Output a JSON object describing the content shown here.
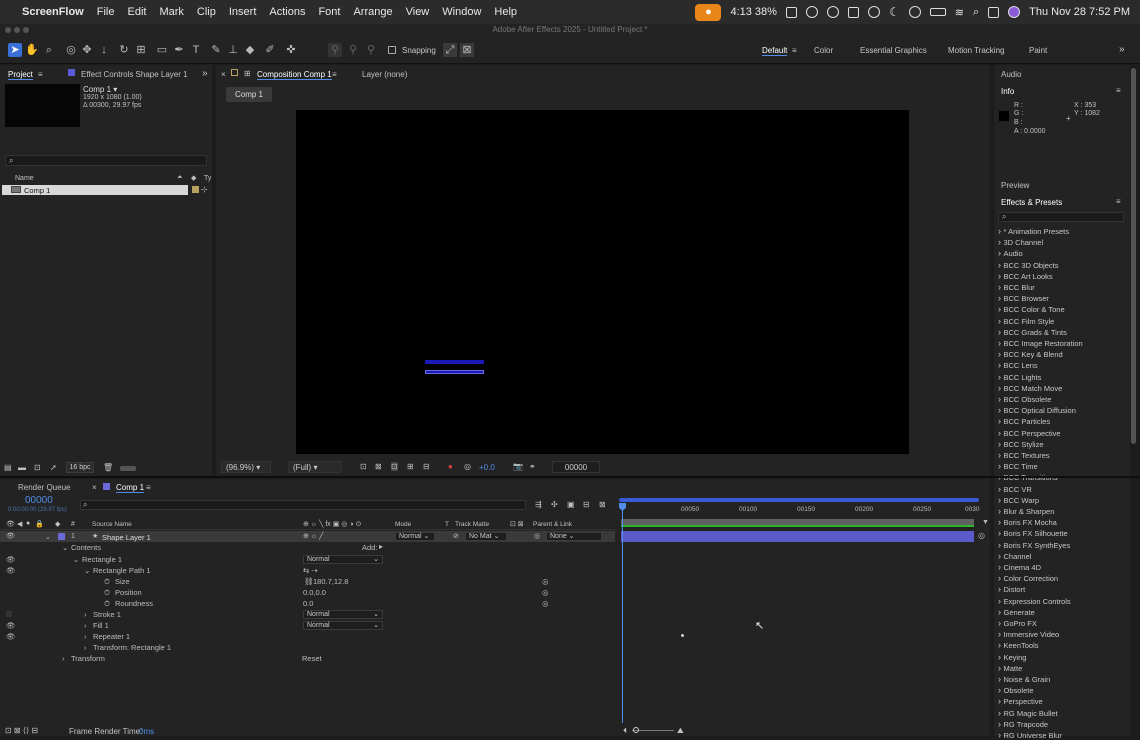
{
  "menubar": {
    "app": "ScreenFlow",
    "items": [
      "File",
      "Edit",
      "Mark",
      "Clip",
      "Insert",
      "Actions",
      "Font",
      "Arrange",
      "View",
      "Window",
      "Help"
    ],
    "battery_time": "4:13 38%",
    "clock": "Thu Nov 28  7:52 PM"
  },
  "window_title": "Adobe After Effects 2025 - Untitled Project *",
  "toolbar": {
    "snapping": "Snapping",
    "workspaces": [
      "Default",
      "Color",
      "Essential Graphics",
      "Motion Tracking",
      "Paint"
    ]
  },
  "project": {
    "tab": "Project",
    "effect_tab": "Effect Controls Shape Layer 1",
    "comp_name": "Comp 1 ▾",
    "comp_size": "1920 x 1080 (1.00)",
    "comp_dur": "Δ 00300, 29.97 fps",
    "col_name": "Name",
    "col_type": "Ty",
    "item": "Comp 1",
    "bpc": "16 bpc"
  },
  "composition": {
    "tab": "Composition Comp 1",
    "layer_tab": "Layer (none)",
    "crumb": "Comp 1",
    "zoom": "(96.9%)",
    "resolution": "(Full)",
    "exposure": "+0.0",
    "timecode": "00000"
  },
  "timeline": {
    "render_tab": "Render Queue",
    "comp_tab": "Comp 1",
    "timecode": "00000",
    "fps": "0:00:00:00 (29.97 fps)",
    "col_source": "Source Name",
    "col_mode": "Mode",
    "col_t": "T",
    "col_matte": "Track Matte",
    "col_parent": "Parent & Link",
    "layer_num": "1",
    "layer_name": "Shape Layer 1",
    "layer_mode": "Normal",
    "layer_matte": "No Mat",
    "layer_parent": "None",
    "contents": "Contents",
    "add": "Add:",
    "rect1": "Rectangle 1",
    "rect1_mode": "Normal",
    "rectpath": "Rectangle Path 1",
    "size_label": "Size",
    "size_val": "180.7,12.8",
    "pos_label": "Position",
    "pos_val": "0.0,0.0",
    "round_label": "Roundness",
    "round_val": "0.0",
    "stroke": "Stroke 1",
    "stroke_mode": "Normal",
    "fill": "Fill 1",
    "fill_mode": "Normal",
    "repeater": "Repeater 1",
    "trect": "Transform: Rectangle 1",
    "transform": "Transform",
    "reset": "Reset",
    "ruler": [
      "00050",
      "00100",
      "00150",
      "00200",
      "00250",
      "0030"
    ],
    "render_time_label": "Frame Render Time:",
    "render_time": "0ms"
  },
  "info": {
    "audio": "Audio",
    "title": "Info",
    "r": "R :",
    "g": "G :",
    "b": "B :",
    "a": "A :  0.0000",
    "x": "X : 353",
    "y": "Y : 1082"
  },
  "preview": "Preview",
  "effects": {
    "title": "Effects & Presets",
    "items": [
      "* Animation Presets",
      "3D Channel",
      "Audio",
      "BCC 3D Objects",
      "BCC Art Looks",
      "BCC Blur",
      "BCC Browser",
      "BCC Color & Tone",
      "BCC Film Style",
      "BCC Grads & Tints",
      "BCC Image Restoration",
      "BCC Key & Blend",
      "BCC Lens",
      "BCC Lights",
      "BCC Match Move",
      "BCC Obsolete",
      "BCC Optical Diffusion",
      "BCC Particles",
      "BCC Perspective",
      "BCC Stylize",
      "BCC Textures",
      "BCC Time",
      "BCC Transitions",
      "BCC VR",
      "BCC Warp",
      "Blur & Sharpen",
      "Boris FX Mocha",
      "Boris FX Silhouette",
      "Boris FX SynthEyes",
      "Channel",
      "Cinema 4D",
      "Color Correction",
      "Distort",
      "Expression Controls",
      "Generate",
      "GoPro FX",
      "Immersive Video",
      "KeenTools",
      "Keying",
      "Matte",
      "Noise & Grain",
      "Obsolete",
      "Perspective",
      "RG Magic Bullet",
      "RG Trapcode",
      "RG Universe Blur"
    ]
  }
}
